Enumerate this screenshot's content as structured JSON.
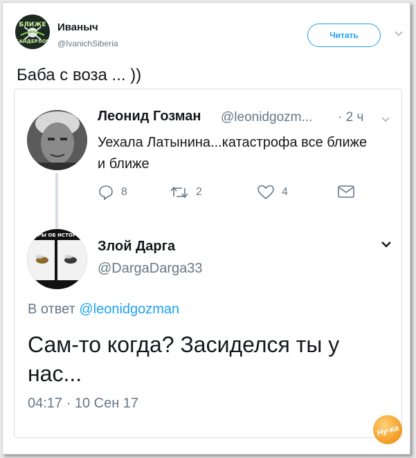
{
  "outer_tweet": {
    "avatar_text": [
      "БЛИЖЕ",
      "БАНДЕРЛОГИ"
    ],
    "name": "Иваныч",
    "handle": "@IvanichSiberia",
    "follow_label": "Читать",
    "text": "Баба с воза ... ))"
  },
  "quoted_tweet_a": {
    "name": "Леонид Гозман",
    "handle": "@leonidgozm...",
    "time": "· 2 ч",
    "text": "Уехала Латынина...катастрофа все ближе и ближе",
    "actions": {
      "replies": "8",
      "retweets": "2",
      "likes": "4"
    }
  },
  "quoted_tweet_b": {
    "avatar_text": "ВОРЫ ОБ ИСТОРИИ",
    "name": "Злой Дарга",
    "handle": "@DargaDarga33",
    "reply_prefix": "В ответ",
    "reply_mention": "@leonidgozman",
    "text": "Сам-то когда? Засиделся ты у нас...",
    "datetime": "04:17 · 10 Сен 17"
  },
  "watermark": {
    "text": "Ну-ка"
  },
  "colors": {
    "accent": "#1da1f2",
    "muted": "#657786",
    "text": "#14171a",
    "border": "#d6dde2"
  }
}
